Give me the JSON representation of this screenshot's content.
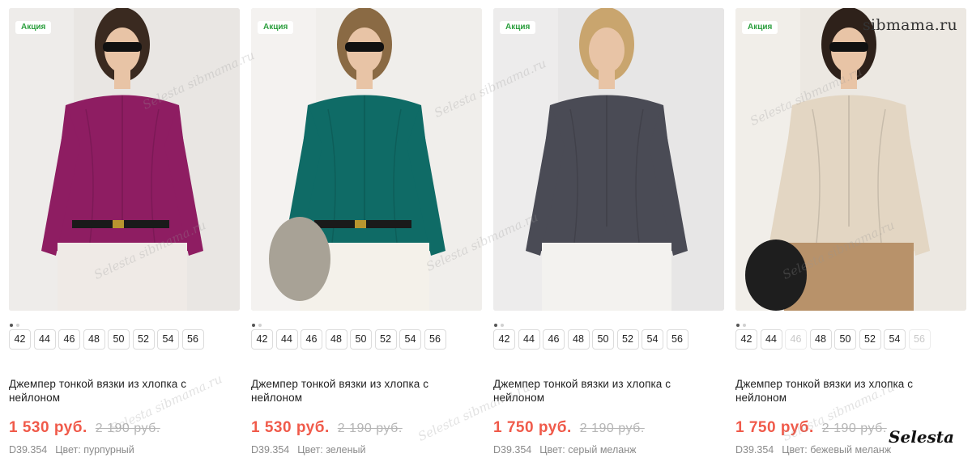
{
  "products": [
    {
      "badge": "Акция",
      "title": "Джемпер тонкой вязки из хлопка с нейлоном",
      "price": "1 530 руб.",
      "old_price": "2 190 руб.",
      "code": "D39.354",
      "color_label": "Цвет: пурпурный",
      "sweater_color": "#8e1d62",
      "sizes": [
        {
          "label": "42",
          "available": true
        },
        {
          "label": "44",
          "available": true
        },
        {
          "label": "46",
          "available": true
        },
        {
          "label": "48",
          "available": true
        },
        {
          "label": "50",
          "available": true
        },
        {
          "label": "52",
          "available": true
        },
        {
          "label": "54",
          "available": true
        },
        {
          "label": "56",
          "available": true
        }
      ]
    },
    {
      "badge": "Акция",
      "title": "Джемпер тонкой вязки из хлопка с нейлоном",
      "price": "1 530 руб.",
      "old_price": "2 190 руб.",
      "code": "D39.354",
      "color_label": "Цвет: зеленый",
      "sweater_color": "#0f6b66",
      "sizes": [
        {
          "label": "42",
          "available": true
        },
        {
          "label": "44",
          "available": true
        },
        {
          "label": "46",
          "available": true
        },
        {
          "label": "48",
          "available": true
        },
        {
          "label": "50",
          "available": true
        },
        {
          "label": "52",
          "available": true
        },
        {
          "label": "54",
          "available": true
        },
        {
          "label": "56",
          "available": true
        }
      ]
    },
    {
      "badge": "Акция",
      "title": "Джемпер тонкой вязки из хлопка с нейлоном",
      "price": "1 750 руб.",
      "old_price": "2 190 руб.",
      "code": "D39.354",
      "color_label": "Цвет: серый меланж",
      "sweater_color": "#4a4b55",
      "sizes": [
        {
          "label": "42",
          "available": true
        },
        {
          "label": "44",
          "available": true
        },
        {
          "label": "46",
          "available": true
        },
        {
          "label": "48",
          "available": true
        },
        {
          "label": "50",
          "available": true
        },
        {
          "label": "52",
          "available": true
        },
        {
          "label": "54",
          "available": true
        },
        {
          "label": "56",
          "available": true
        }
      ]
    },
    {
      "badge": "Акция",
      "title": "Джемпер тонкой вязки из хлопка с нейлоном",
      "price": "1 750 руб.",
      "old_price": "2 190 руб.",
      "code": "D39.354",
      "color_label": "Цвет: бежевый меланж",
      "sweater_color": "#e3d6c3",
      "sizes": [
        {
          "label": "42",
          "available": true
        },
        {
          "label": "44",
          "available": true
        },
        {
          "label": "46",
          "available": false
        },
        {
          "label": "48",
          "available": true
        },
        {
          "label": "50",
          "available": true
        },
        {
          "label": "52",
          "available": true
        },
        {
          "label": "54",
          "available": true
        },
        {
          "label": "56",
          "available": false
        }
      ]
    }
  ],
  "site_watermark": "sibmama.ru",
  "photo_watermark": "Selesta sibmama.ru",
  "brand_watermark": "Selesta",
  "colors": {
    "badge_text": "#2c9f3e",
    "price": "#f05a4a",
    "old_price": "#b5b5b5",
    "meta": "#8a8a8a"
  }
}
